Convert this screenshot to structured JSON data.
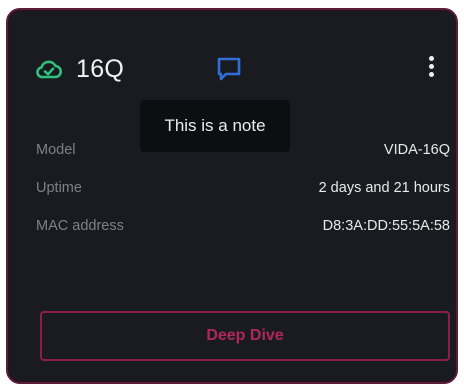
{
  "device": {
    "name": "16Q",
    "status_icon": "cloud-check-icon",
    "note_icon": "note-icon",
    "menu_icon": "vertical-dots-icon"
  },
  "tooltip": {
    "text": "This is a note"
  },
  "details": [
    {
      "label": "Model",
      "value": "VIDA-16Q"
    },
    {
      "label": "Uptime",
      "value": "2 days and 21 hours"
    },
    {
      "label": "MAC address",
      "value": "D8:3A:DD:55:5A:58"
    }
  ],
  "actions": {
    "deep_dive_label": "Deep Dive"
  },
  "colors": {
    "card_background": "#1a1b20",
    "card_border": "#5a1d3b",
    "status_green": "#2ec27e",
    "note_blue": "#2f6fd6",
    "accent_pink": "#b0275f"
  }
}
